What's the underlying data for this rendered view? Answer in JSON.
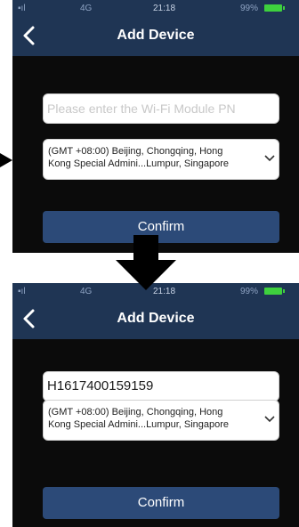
{
  "status_bar": {
    "signal": "▪ıl",
    "carrier": "4G",
    "time": "21:18",
    "battery": "99%"
  },
  "nav": {
    "title": "Add Device",
    "back_icon": "chevron-left-icon"
  },
  "screen1": {
    "pn_placeholder": "Please enter the Wi-Fi Module PN",
    "timezone_line1": "(GMT +08:00) Beijing, Chongqing, Hong",
    "timezone_line2": "Kong Special Admini...Lumpur, Singapore",
    "confirm_label": "Confirm"
  },
  "screen2": {
    "pn_value": "H1617400159159",
    "timezone_line1": "(GMT +08:00) Beijing, Chongqing, Hong",
    "timezone_line2": "Kong Special Admini...Lumpur, Singapore",
    "confirm_label": "Confirm"
  },
  "annotations": {
    "side_arrow": "arrow-right-icon",
    "down_arrow": "arrow-down-icon"
  },
  "colors": {
    "nav_bg": "#1f3554",
    "screen_bg": "#0b0b0b",
    "button_bg": "#2c4a78",
    "battery": "#3ed13e"
  }
}
